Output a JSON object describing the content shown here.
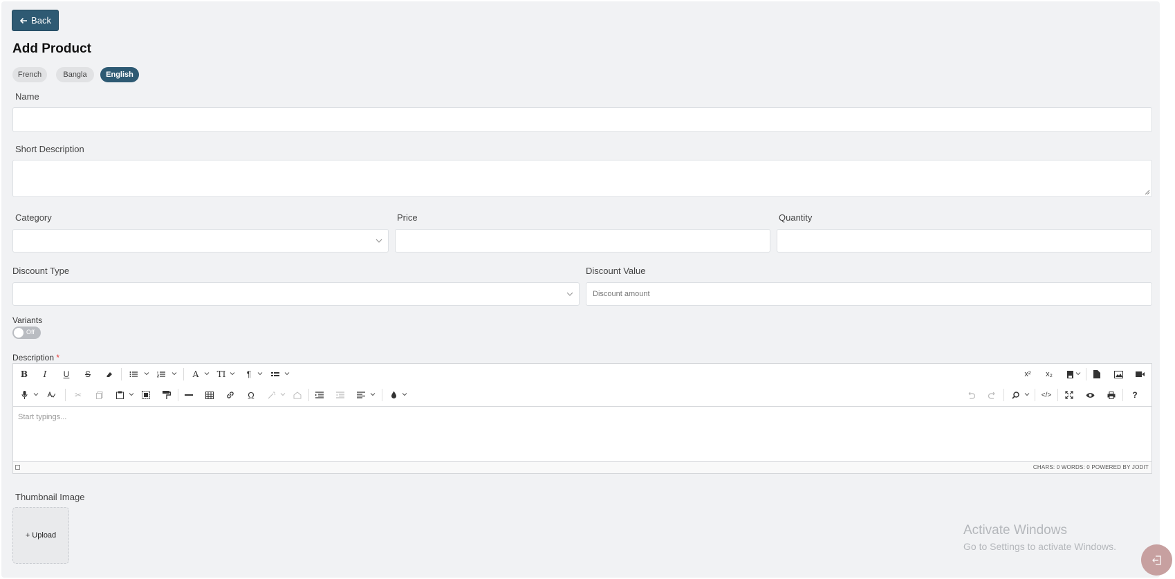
{
  "header": {
    "back_label": "Back",
    "title": "Add Product"
  },
  "languages": [
    {
      "label": "French",
      "active": false
    },
    {
      "label": "Bangla",
      "active": false
    },
    {
      "label": "English",
      "active": true
    }
  ],
  "form": {
    "name_label": "Name",
    "name_value": "",
    "short_description_label": "Short Description",
    "category_label": "Category",
    "price_label": "Price",
    "quantity_label": "Quantity",
    "discount_type_label": "Discount Type",
    "discount_value_label": "Discount Value",
    "discount_value_placeholder": "Discount amount",
    "variants_label": "Variants",
    "variants_toggle_text": "Off",
    "description_label": "Description",
    "required_mark": "*",
    "thumbnail_label": "Thumbnail Image",
    "upload_label": "+ Upload"
  },
  "editor": {
    "placeholder": "Start typings...",
    "status": "CHARS: 0   WORDS: 0   POWERED BY JODIT"
  },
  "watermark": {
    "line1": "Activate Windows",
    "line2": "Go to Settings to activate Windows."
  },
  "colors": {
    "accent": "#2e5a73",
    "background": "#f1f2f4"
  }
}
